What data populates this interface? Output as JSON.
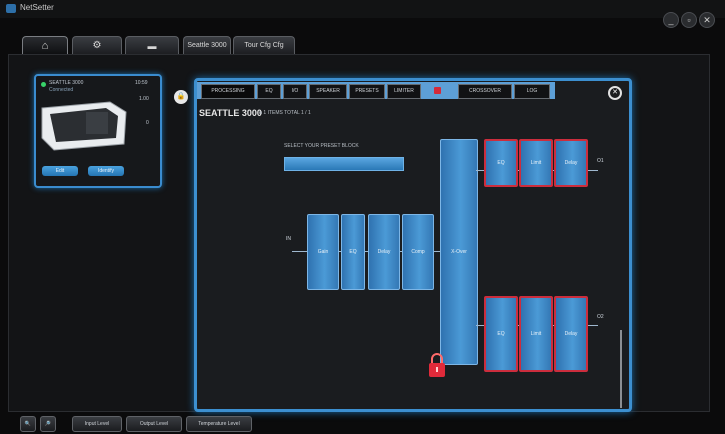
{
  "window": {
    "title": "NetSetter",
    "min_icon": "minimize-icon",
    "restore_icon": "restore-icon",
    "close_icon": "close-icon"
  },
  "nav": {
    "home_icon": "home-icon",
    "settings_icon": "gear-icon",
    "folder_icon": "folder-icon",
    "tabs": [
      "Seattle 3000",
      "Tour Cfg Cfg"
    ]
  },
  "device_card": {
    "name": "SEATTLE 3000",
    "status": "Connected",
    "value_top": "10:59",
    "value_mid": "1.00",
    "value_right": "0",
    "btn_left": "Edit",
    "btn_right": "Identify",
    "lock_icon": "padlock-icon"
  },
  "panel": {
    "tabs": [
      "PROCESSING",
      "EQ",
      "I/O",
      "SPEAKER",
      "PRESETS",
      "LIMITER",
      "CROSSOVER",
      "LOG"
    ],
    "alert_icon": "warning-icon",
    "close_icon": "close-icon",
    "title": "SEATTLE 3000",
    "subtitle": "■ 1 ITEMS TOTAL 1 / 1",
    "preset_label": "SELECT YOUR PRESET BLOCK",
    "input_label": "IN",
    "out_top_label": "O1",
    "out_bottom_label": "O2",
    "input_chain": [
      "Gain",
      "EQ",
      "Delay",
      "Comp"
    ],
    "xover_label": "X-Over",
    "top_chain": [
      "EQ",
      "Limit",
      "Delay"
    ],
    "bottom_chain": [
      "EQ",
      "Limit",
      "Delay"
    ]
  },
  "bottom_bar": {
    "search_icon": "magnifier-icon",
    "zoom_icon": "zoom-icon",
    "buttons": [
      "Input Level",
      "Output Level",
      "Temperature Level"
    ]
  },
  "colors": {
    "accent_blue": "#3c8fd0",
    "block_red": "#cc2d3d"
  }
}
